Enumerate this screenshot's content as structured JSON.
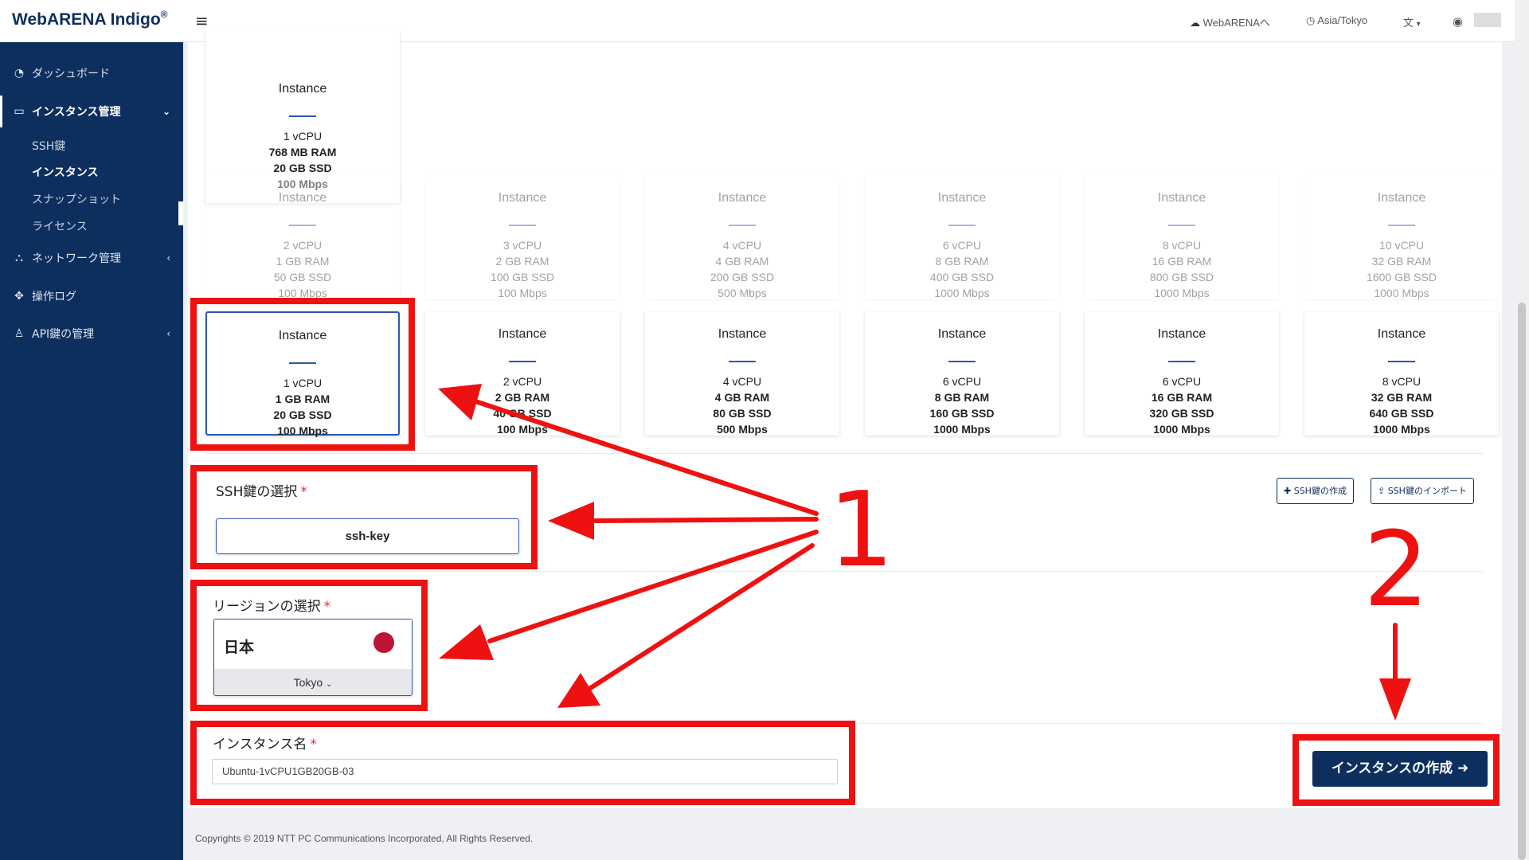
{
  "header": {
    "logo": "WebARENA Indigo",
    "logo_mark": "®",
    "webarena_link": "WebARENAへ",
    "timezone": "Asia/Tokyo"
  },
  "sidebar": {
    "items": [
      {
        "label": "ダッシュボード",
        "icon": "dashboard-icon"
      },
      {
        "label": "インスタンス管理",
        "icon": "monitor-icon"
      },
      {
        "label": "ネットワーク管理",
        "icon": "network-icon"
      },
      {
        "label": "操作ログ",
        "icon": "log-icon"
      },
      {
        "label": "API鍵の管理",
        "icon": "user-icon"
      }
    ],
    "subitems": [
      "SSH鍵",
      "インスタンス",
      "スナップショット",
      "ライセンス"
    ]
  },
  "plans": {
    "top": {
      "name": "Instance",
      "specs": [
        "1 vCPU",
        "768 MB RAM",
        "20 GB SSD",
        "100 Mbps"
      ]
    },
    "row2": [
      {
        "name": "Instance",
        "specs": [
          "2 vCPU",
          "1 GB RAM",
          "50 GB SSD",
          "100 Mbps"
        ]
      },
      {
        "name": "Instance",
        "specs": [
          "3 vCPU",
          "2 GB RAM",
          "100 GB SSD",
          "100 Mbps"
        ]
      },
      {
        "name": "Instance",
        "specs": [
          "4 vCPU",
          "4 GB RAM",
          "200 GB SSD",
          "500 Mbps"
        ]
      },
      {
        "name": "Instance",
        "specs": [
          "6 vCPU",
          "8 GB RAM",
          "400 GB SSD",
          "1000 Mbps"
        ]
      },
      {
        "name": "Instance",
        "specs": [
          "8 vCPU",
          "16 GB RAM",
          "800 GB SSD",
          "1000 Mbps"
        ]
      },
      {
        "name": "Instance",
        "specs": [
          "10 vCPU",
          "32 GB RAM",
          "1600 GB SSD",
          "1000 Mbps"
        ]
      }
    ],
    "row3": [
      {
        "name": "Instance",
        "specs": [
          "1 vCPU",
          "1 GB RAM",
          "20 GB SSD",
          "100 Mbps"
        ]
      },
      {
        "name": "Instance",
        "specs": [
          "2 vCPU",
          "2 GB RAM",
          "40 GB SSD",
          "100 Mbps"
        ]
      },
      {
        "name": "Instance",
        "specs": [
          "4 vCPU",
          "4 GB RAM",
          "80 GB SSD",
          "500 Mbps"
        ]
      },
      {
        "name": "Instance",
        "specs": [
          "6 vCPU",
          "8 GB RAM",
          "160 GB SSD",
          "1000 Mbps"
        ]
      },
      {
        "name": "Instance",
        "specs": [
          "6 vCPU",
          "16 GB RAM",
          "320 GB SSD",
          "1000 Mbps"
        ]
      },
      {
        "name": "Instance",
        "specs": [
          "8 vCPU",
          "32 GB RAM",
          "640 GB SSD",
          "1000 Mbps"
        ]
      }
    ]
  },
  "ssh": {
    "label": "SSH鍵の選択",
    "required": "*",
    "selected": "ssh-key",
    "create_btn": "SSH鍵の作成",
    "import_btn": "SSH鍵のインポート"
  },
  "region": {
    "label": "リージョンの選択",
    "required": "*",
    "country": "日本",
    "city": "Tokyo",
    "flag_color": "#bc1434"
  },
  "instance_name": {
    "label": "インスタンス名",
    "required": "*",
    "value": "Ubuntu-1vCPU1GB20GB-03"
  },
  "create_button": "インスタンスの作成",
  "footer": "Copyrights © 2019 NTT PC Communications Incorporated, All Rights Reserved.",
  "annotations": {
    "step1": "1",
    "step2": "2",
    "color": "#ee1111"
  },
  "colors": {
    "brand": "#0d2f5e",
    "accent": "#2d58b3"
  }
}
